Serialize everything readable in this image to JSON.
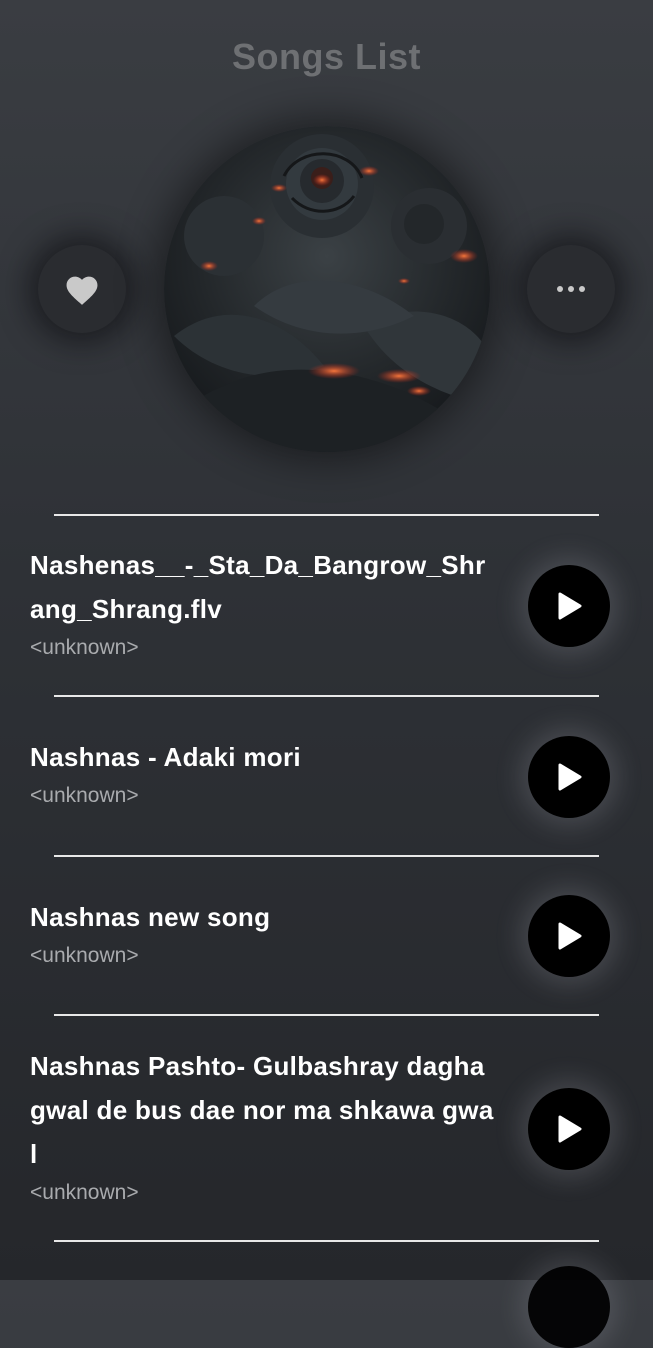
{
  "header": {
    "title": "Songs List"
  },
  "now_playing": {
    "favorite_icon": "heart-icon",
    "more_icon": "more-horizontal-icon",
    "cover_description_colors": {
      "dark": "#1c1f22",
      "ember": "#e2452a"
    }
  },
  "songs": [
    {
      "title": "Nashenas__-_Sta_Da_Bangrow_Shrang_Shrang.flv",
      "artist": "<unknown>"
    },
    {
      "title": "Nashnas - Adaki mori",
      "artist": "<unknown>"
    },
    {
      "title": "Nashnas new song",
      "artist": "<unknown>"
    },
    {
      "title": "Nashnas Pashto- Gulbashray dagha gwal de bus dae nor ma shkawa gwal",
      "artist": "<unknown>"
    }
  ],
  "colors": {
    "background": "#2e3136",
    "title": "#6e7073",
    "divider": "#e8e8e8",
    "play_button": "#000000",
    "artist_text": "#a9abae"
  }
}
